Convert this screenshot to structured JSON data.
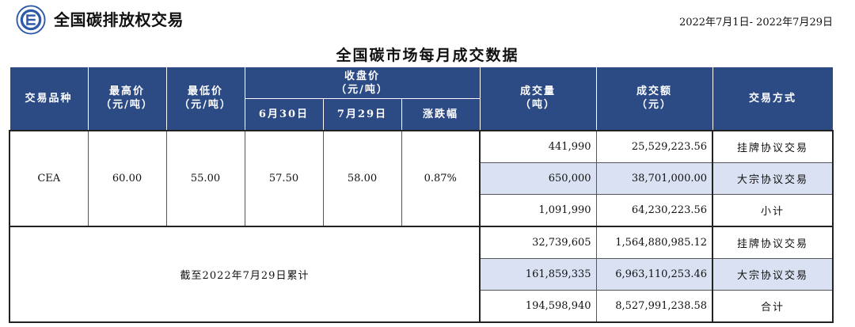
{
  "header": {
    "brand": "全国碳排放权交易",
    "date_range": "2022年7月1日- 2022年7月29日"
  },
  "title": "全国碳市场每月成交数据",
  "table": {
    "headers": {
      "product": "交易品种",
      "high": "最高价",
      "high_unit": "（元/吨）",
      "low": "最低价",
      "low_unit": "（元/吨）",
      "close": "收盘价",
      "close_unit": "（元/吨）",
      "close_d1": "6月30日",
      "close_d2": "7月29日",
      "change": "涨跌幅",
      "volume": "成交量",
      "volume_unit": "（吨）",
      "amount": "成交额",
      "amount_unit": "（元）",
      "mode": "交易方式"
    },
    "monthly": {
      "product": "CEA",
      "high": "60.00",
      "low": "55.00",
      "close_d1": "57.50",
      "close_d2": "58.00",
      "change": "0.87%",
      "rows": [
        {
          "volume": "441,990",
          "amount": "25,529,223.56",
          "mode": "挂牌协议交易"
        },
        {
          "volume": "650,000",
          "amount": "38,701,000.00",
          "mode": "大宗协议交易"
        },
        {
          "volume": "1,091,990",
          "amount": "64,230,223.56",
          "mode": "小计"
        }
      ]
    },
    "cumulative": {
      "label": "截至2022年7月29日累计",
      "rows": [
        {
          "volume": "32,739,605",
          "amount": "1,564,880,985.12",
          "mode": "挂牌协议交易"
        },
        {
          "volume": "161,859,335",
          "amount": "6,963,110,253.46",
          "mode": "大宗协议交易"
        },
        {
          "volume": "194,598,940",
          "amount": "8,527,991,238.58",
          "mode": "合计"
        }
      ]
    }
  },
  "colors": {
    "header_bg": "#2c4a84",
    "highlight": "#d9e1f2",
    "logo": "#2e5aa8"
  }
}
